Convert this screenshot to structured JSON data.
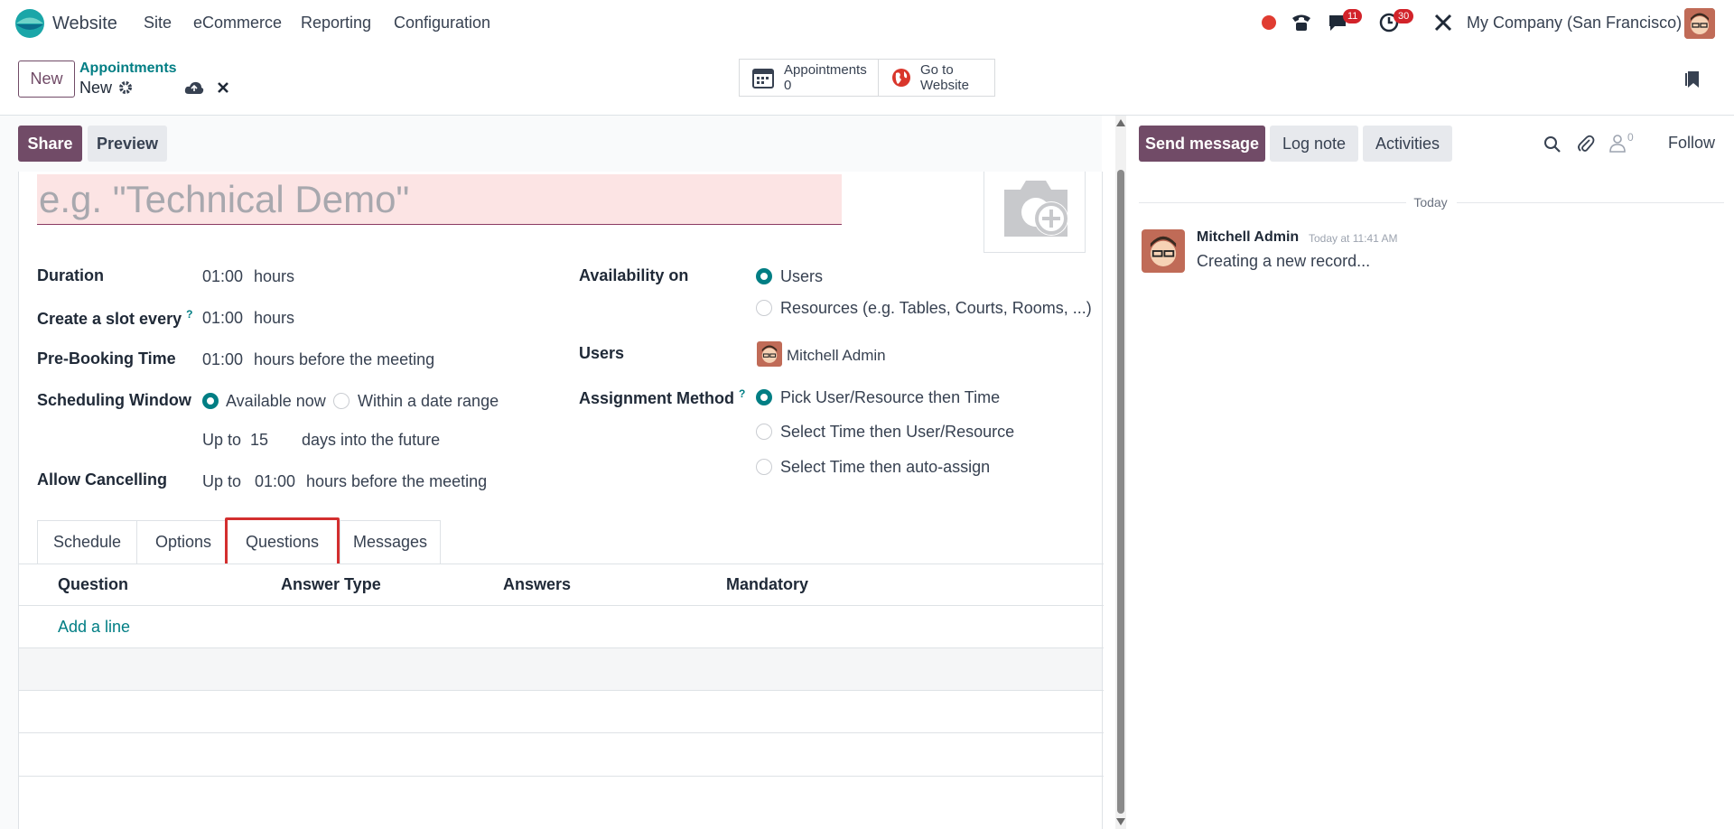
{
  "app": {
    "name": "Website"
  },
  "nav": {
    "menu": [
      "Site",
      "eCommerce",
      "Reporting",
      "Configuration"
    ],
    "messages_count": "11",
    "activities_count": "30",
    "company": "My Company (San Francisco)"
  },
  "control": {
    "new_label": "New",
    "breadcrumb_parent": "Appointments",
    "breadcrumb_current": "New",
    "stat_appointments_label": "Appointments",
    "stat_appointments_value": "0",
    "stat_website_line1": "Go to",
    "stat_website_line2": "Website"
  },
  "form": {
    "share_label": "Share",
    "preview_label": "Preview",
    "name_placeholder": "e.g. \"Technical Demo\"",
    "duration_label": "Duration",
    "duration_value": "01:00",
    "duration_unit": "hours",
    "slot_label": "Create a slot every",
    "slot_value": "01:00",
    "slot_unit": "hours",
    "prebooking_label": "Pre-Booking Time",
    "prebooking_value": "01:00",
    "prebooking_unit": "hours before the meeting",
    "window_label": "Scheduling Window",
    "window_opt1": "Available now",
    "window_opt2": "Within a date range",
    "upto_label": "Up to",
    "upto_value": "15",
    "upto_unit": "days into the future",
    "cancel_label": "Allow Cancelling",
    "cancel_upto": "Up to",
    "cancel_value": "01:00",
    "cancel_unit": "hours before the meeting",
    "availability_label": "Availability on",
    "availability_opt1": "Users",
    "availability_opt2": "Resources (e.g. Tables, Courts, Rooms, ...)",
    "users_label": "Users",
    "users_value": "Mitchell Admin",
    "assign_label": "Assignment Method",
    "assign_opt1": "Pick User/Resource then Time",
    "assign_opt2": "Select Time then User/Resource",
    "assign_opt3": "Select Time then auto-assign",
    "help_mark": "?"
  },
  "tabs": [
    "Schedule",
    "Options",
    "Questions",
    "Messages"
  ],
  "table": {
    "headers": [
      "Question",
      "Answer Type",
      "Answers",
      "Mandatory"
    ],
    "add_line": "Add a line"
  },
  "chatter": {
    "send_message": "Send message",
    "log_note": "Log note",
    "activities": "Activities",
    "followers_count": "0",
    "follow": "Follow",
    "date_separator": "Today",
    "author": "Mitchell Admin",
    "time": "Today at 11:41 AM",
    "body": "Creating a new record..."
  },
  "colors": {
    "brand": "#714b67",
    "accent": "#017e84",
    "highlight": "#d32f2f",
    "required_bg": "#fce4e4"
  }
}
